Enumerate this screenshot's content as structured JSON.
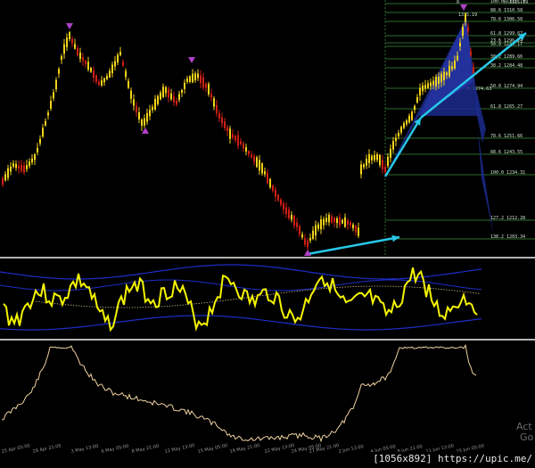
{
  "colors": {
    "background": "#000000",
    "candle_up": "#f2d21b",
    "candle_down": "#d01f14",
    "fib_line": "#2e6b2e",
    "fib_label": "#cfe8cf",
    "pattern_fill": "#1b2a8c",
    "trend_arrow": "#28c8e8",
    "marker_top": "#b140c8",
    "oscillator": "#f5f500",
    "bands": "#1e2fc8",
    "mid_line": "#c8b48a",
    "lower_line": "#f0d2a0",
    "separator": "#b4b4b4"
  },
  "fib_levels": [
    {
      "pct": "100.0",
      "price": "1315.19"
    },
    {
      "pct": "88.6",
      "price": "1310.58"
    },
    {
      "pct": "78.6",
      "price": "1306.50"
    },
    {
      "pct": "61.8",
      "price": "1299.67"
    },
    {
      "pct": "50.0",
      "price": "1294.17"
    },
    {
      "pct": "38.2",
      "price": "1289.66"
    },
    {
      "pct": "23.6",
      "price": "1296.24"
    },
    {
      "pct": "38.2",
      "price": "1284.48"
    },
    {
      "pct": "50.0",
      "price": "1274.94"
    },
    {
      "pct": "61.8",
      "price": "1265.27"
    },
    {
      "pct": "78.6",
      "price": "1251.66"
    },
    {
      "pct": "88.6",
      "price": "1243.55"
    },
    {
      "pct": "100.0",
      "price": "1234.31"
    },
    {
      "pct": "127.2",
      "price": "1212.28"
    },
    {
      "pct": "138.2",
      "price": "1203.34"
    }
  ],
  "top_right_labels": {
    "left": "0",
    "right": "H 1315.19"
  },
  "right_fragment_labels": [
    "0 1274.63",
    "1315.19"
  ],
  "dates": [
    "25 Apr 05:00",
    "29 Apr 21:00",
    "3 May 13:00",
    "6 May 05:00",
    "8 May 21:00",
    "12 May 13:00",
    "15 May 05:00",
    "19 May 21:00",
    "22 May 13:00",
    "24 May 05:00",
    "27 May 21:00",
    "2 Jun 13:00",
    "4 Jun 05:00",
    "8 Jun 21:00",
    "11 Jun 13:00",
    "15 Jun 05:00"
  ],
  "watermark": "Act\nGo t",
  "stamp": "[1056x892] https://upic.me/"
}
